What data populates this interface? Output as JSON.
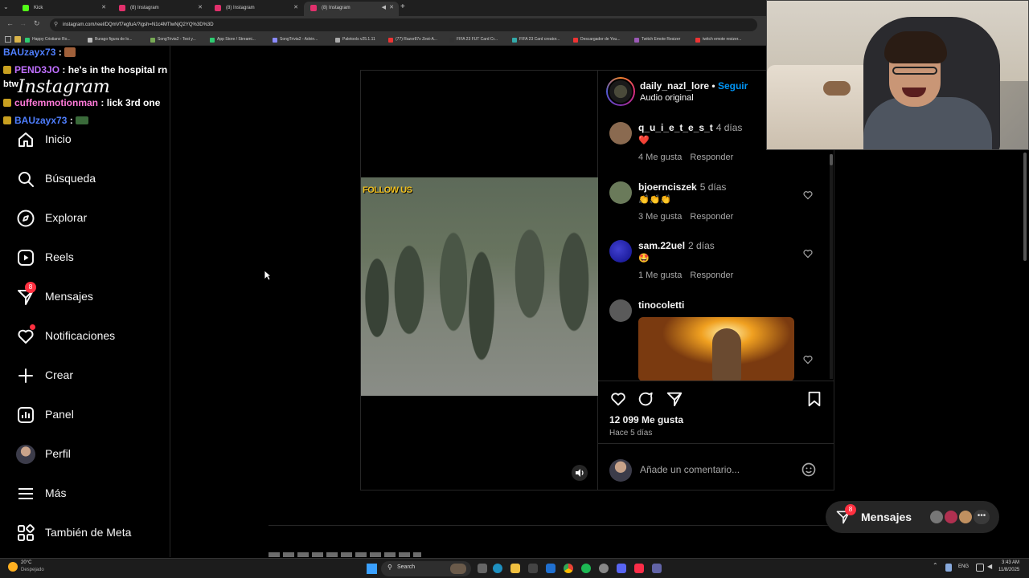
{
  "browser": {
    "tabs": [
      {
        "title": "Kick",
        "color": "#53fc18"
      },
      {
        "title": "(8) Instagram",
        "color": "#e1306c"
      },
      {
        "title": "(8) Instagram",
        "color": "#e1306c"
      },
      {
        "title": "(8) Instagram",
        "color": "#e1306c"
      }
    ],
    "url": "instagram.com/reel/DQmVf7egfuA/?igsh=N1c4MTlwNjQ2YQ%3D%3D",
    "bookmarks": [
      "Happy Cristiano Ro...",
      "Burago figura de lo...",
      "SongTrivia2 - Test y...",
      "App Store / Streami...",
      "SongTrivia2 - Advin...",
      "Paletools v25.1.11",
      "(77) Razor87x Zest-A...",
      "FIFA 23 FUT Card Cr...",
      "FIFA 23 Card creator...",
      "Descargador de You...",
      "Twitch Emote Resizer",
      "twitch emote resizer..."
    ]
  },
  "chat": [
    {
      "user": "BAUzayx73",
      "user_color": "#4f7fff",
      "sep": ":",
      "message": ""
    },
    {
      "user": "PEND3JO",
      "user_color": "#c070ff",
      "sep": ":",
      "message": "he's in the hospital rn"
    },
    {
      "user": "btw",
      "user_color": "#ffffff",
      "sep": "",
      "message": ""
    },
    {
      "user": "cuffemmotionman",
      "user_color": "#ff7ad9",
      "sep": ":",
      "message": "lick 3rd one"
    },
    {
      "user": "BAUzayx73",
      "user_color": "#4f7fff",
      "sep": ":",
      "message": ""
    }
  ],
  "instagram_logo": "Instagram",
  "sidebar": {
    "items": [
      {
        "label": "Inicio",
        "icon": "home-icon"
      },
      {
        "label": "Búsqueda",
        "icon": "search-icon"
      },
      {
        "label": "Explorar",
        "icon": "compass-icon"
      },
      {
        "label": "Reels",
        "icon": "reels-icon"
      },
      {
        "label": "Mensajes",
        "icon": "messages-icon",
        "badge": "8"
      },
      {
        "label": "Notificaciones",
        "icon": "heart-icon"
      },
      {
        "label": "Crear",
        "icon": "plus-icon"
      },
      {
        "label": "Panel",
        "icon": "chart-icon"
      },
      {
        "label": "Perfil",
        "icon": "avatar-icon"
      },
      {
        "label": "Más",
        "icon": "menu-icon"
      },
      {
        "label": "También de Meta",
        "icon": "meta-icon"
      }
    ]
  },
  "post": {
    "overlay_text": "FOLLOW US",
    "author": "daily_nazl_lore",
    "follow_label": "Seguir",
    "audio": "Audio original",
    "likes": "12 099 Me gusta",
    "posted": "Hace 5 días",
    "comment_placeholder": "Añade un comentario...",
    "comments": [
      {
        "user": "q_u_i_e_t_e_s_t",
        "time": "4 días",
        "text": "❤️",
        "likes": "4 Me gusta",
        "reply": "Responder",
        "avatar_color": "#8a6a50",
        "has_heart": false
      },
      {
        "user": "bjoernciszek",
        "time": "5 días",
        "text": "👏👏👏",
        "likes": "3 Me gusta",
        "reply": "Responder",
        "avatar_color": "#6a7a5a",
        "has_heart": true
      },
      {
        "user": "sam.22uel",
        "time": "2 días",
        "text": "🤩",
        "likes": "1 Me gusta",
        "reply": "Responder",
        "avatar_color": "#2a2aa0",
        "has_heart": true
      },
      {
        "user": "tinocoletti",
        "time": "",
        "text": "",
        "likes": "",
        "reply": "",
        "avatar_color": "#5a5a5a",
        "has_heart": true
      }
    ]
  },
  "messages_pill": {
    "label": "Mensajes",
    "badge": "8"
  },
  "taskbar": {
    "weather_temp": "20°C",
    "weather_desc": "Despejado",
    "search": "Search",
    "lang": "ENG",
    "time": "3:43 AM",
    "date": "11/8/2025"
  },
  "colors": {
    "accent_blue": "#0095f6",
    "badge_red": "#ff3040",
    "text_secondary": "#a8a8a8"
  }
}
